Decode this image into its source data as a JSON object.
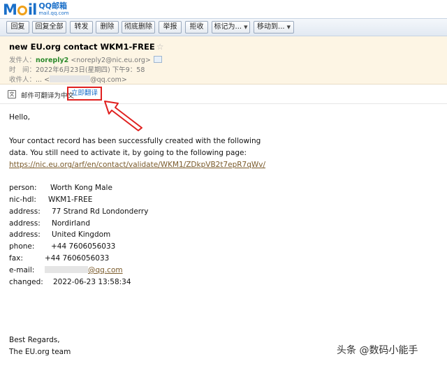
{
  "logo": {
    "qq_text": "QQ邮箱",
    "domain_text": "mail.qq.com"
  },
  "toolbar": {
    "reply": "回复",
    "reply_all": "回复全部",
    "forward": "转发",
    "delete": "删除",
    "delete_permanent": "彻底删除",
    "report": "举报",
    "reject": "拒收",
    "mark_as": "标记为...",
    "move_to": "移动到..."
  },
  "email": {
    "subject": "new EU.org contact WKM1-FREE",
    "star_icon": "star-icon",
    "from_label": "发件人：",
    "from_name": "noreply2",
    "from_addr": "<noreply2@nic.eu.org>",
    "time_label": "时　间：",
    "time_value": "2022年6月23日(星期四) 下午9：58",
    "to_label": "收件人：",
    "to_prefix": "... <",
    "to_suffix": "@qq.com>"
  },
  "translate": {
    "notice": "邮件可翻译为中文",
    "action": "立即翻译",
    "highlight_color": "#e0201f"
  },
  "body": {
    "greeting": "Hello,",
    "para1": "Your contact record has been successfully created with the following",
    "para2": "data. You still need to activate it, by going to the following page:",
    "link": "https://nic.eu.org/arf/en/contact/validate/WKM1/ZDkpVB2t7epR7qWv/",
    "fields": {
      "person_label": "person:",
      "person_value": "Worth Kong Male",
      "nichdl_label": "nic-hdl:",
      "nichdl_value": "WKM1-FREE",
      "address1_label": "address:",
      "address1_value": "77 Strand Rd Londonderry",
      "address2_label": "address:",
      "address2_value": "Nordirland",
      "address3_label": "address:",
      "address3_value": "United Kingdom",
      "phone_label": "phone:",
      "phone_value": "+44 7606056033",
      "fax_label": "fax:",
      "fax_value": "+44 7606056033",
      "email_label": "e-mail:",
      "email_value_suffix": "@qq.com",
      "changed_label": "changed:",
      "changed_value": "2022-06-23 13:58:34"
    },
    "closing": "Best Regards,",
    "signature": "The EU.org team"
  },
  "watermark": "头条 @数码小能手"
}
